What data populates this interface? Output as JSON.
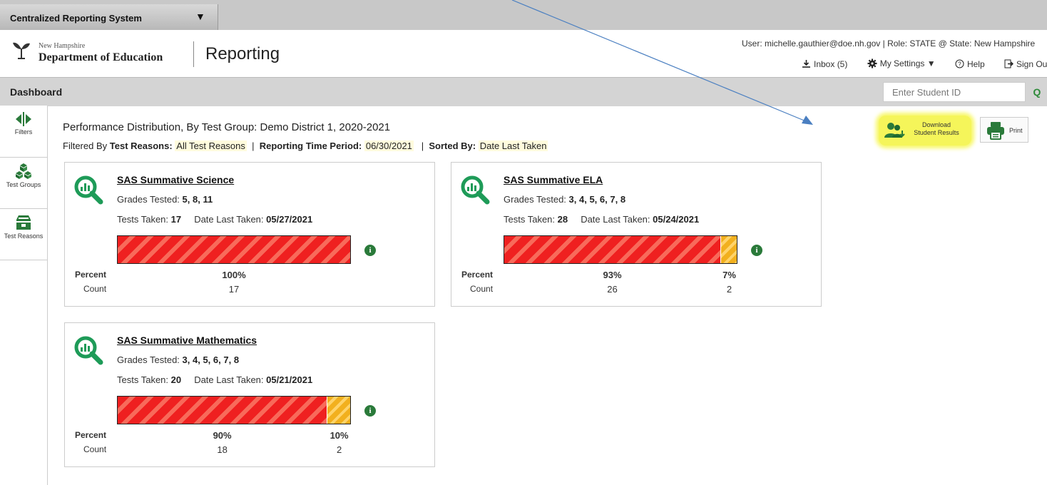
{
  "system": {
    "title": "Centralized Reporting System",
    "menu_caret": "▼"
  },
  "header": {
    "org_small": "New Hampshire",
    "org_name": "Department of Education",
    "app_title": "Reporting",
    "user_line": "User: michelle.gauthier@doe.nh.gov  |  Role: STATE @ State: New Hampshire",
    "links": {
      "inbox": "Inbox (5)",
      "settings": "My Settings ▼",
      "help": "Help",
      "signout": "Sign Out"
    }
  },
  "dashbar": {
    "title": "Dashboard",
    "student_id_placeholder": "Enter Student ID",
    "search_glyph": "Q"
  },
  "sidebar": [
    {
      "label": "Filters",
      "icon": "filters-icon"
    },
    {
      "label": "Test Groups",
      "icon": "test-groups-icon"
    },
    {
      "label": "Test Reasons",
      "icon": "test-reasons-icon"
    }
  ],
  "report": {
    "title": "Performance Distribution, By Test Group: Demo District 1, 2020-2021",
    "filtered_by_label": "Filtered By",
    "test_reasons_label": "Test Reasons:",
    "test_reasons_value": "All Test Reasons",
    "period_label": "Reporting Time Period:",
    "period_value": "06/30/2021",
    "sorted_label": "Sorted By:",
    "sorted_value": "Date Last Taken"
  },
  "actions": {
    "download_line1": "Download",
    "download_line2": "Student Results",
    "print": "Print"
  },
  "labels": {
    "grades_tested": "Grades Tested:",
    "tests_taken": "Tests Taken:",
    "date_last_taken": "Date Last Taken:",
    "percent": "Percent",
    "count": "Count",
    "info": "i"
  },
  "cards": [
    {
      "name": "SAS Summative Science",
      "grades": "5, 8, 11",
      "tests_taken": "17",
      "date_last_taken": "05/27/2021",
      "segments": [
        {
          "percent": "100%",
          "count": "17",
          "fraction": 1.0
        }
      ]
    },
    {
      "name": "SAS Summative ELA",
      "grades": "3, 4, 5, 6, 7, 8",
      "tests_taken": "28",
      "date_last_taken": "05/24/2021",
      "segments": [
        {
          "percent": "93%",
          "count": "26",
          "fraction": 0.93
        },
        {
          "percent": "7%",
          "count": "2",
          "fraction": 0.07
        }
      ]
    },
    {
      "name": "SAS Summative Mathematics",
      "grades": "3, 4, 5, 6, 7, 8",
      "tests_taken": "20",
      "date_last_taken": "05/21/2021",
      "segments": [
        {
          "percent": "90%",
          "count": "18",
          "fraction": 0.9
        },
        {
          "percent": "10%",
          "count": "2",
          "fraction": 0.1
        }
      ]
    }
  ],
  "colors": {
    "red": "#ef2020",
    "yellow": "#f2b01e",
    "green": "#2a7a3a",
    "highlight": "#f5f55a",
    "arrow": "#4a7fc1"
  }
}
